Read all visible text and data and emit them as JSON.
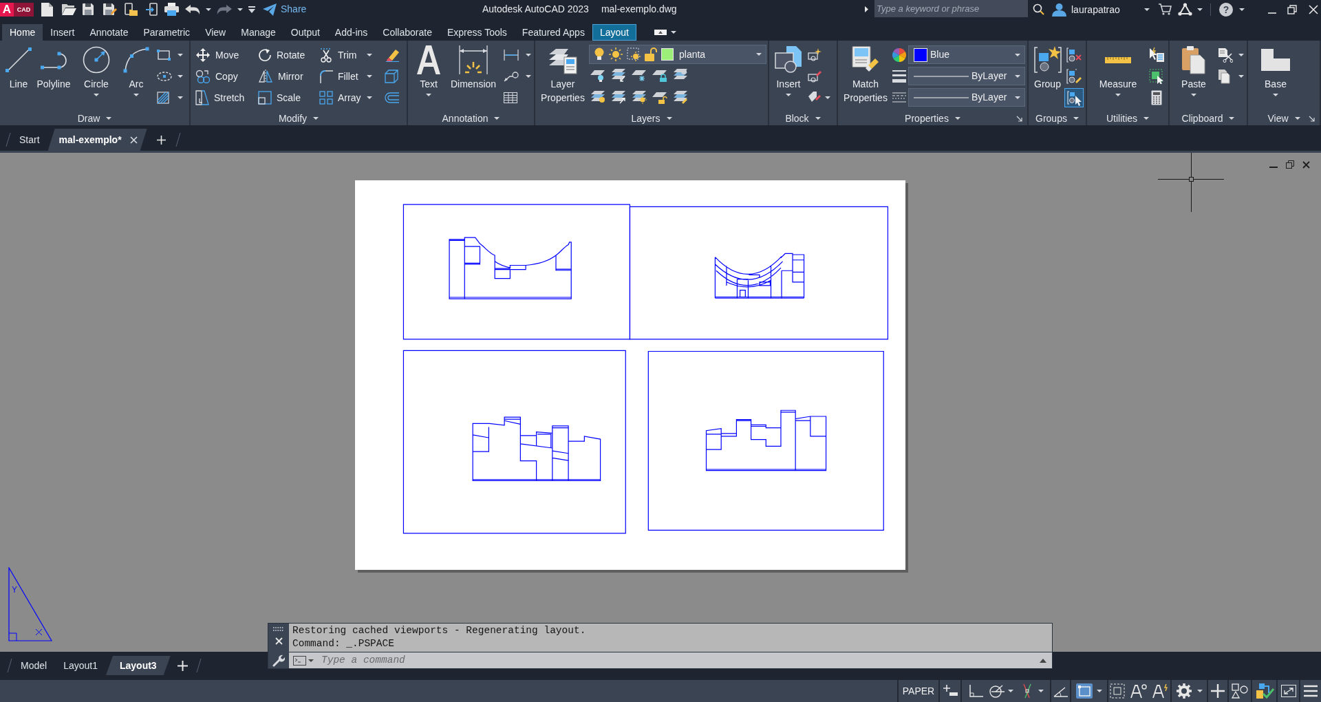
{
  "title_bar": {
    "logo": {
      "mark": "A",
      "text": "CAD"
    },
    "redo": {
      "disabled": true
    },
    "share": "Share",
    "app_title": "Autodesk AutoCAD 2023",
    "file_name": "mal-exemplo.dwg",
    "search": {
      "placeholder": "Type a keyword or phrase"
    },
    "user": "laurapatrao",
    "help": "?"
  },
  "ribbon_tabs": [
    {
      "label": "Home",
      "selected": true,
      "contextual": false
    },
    {
      "label": "Insert",
      "selected": false,
      "contextual": false
    },
    {
      "label": "Annotate",
      "selected": false,
      "contextual": false
    },
    {
      "label": "Parametric",
      "selected": false,
      "contextual": false
    },
    {
      "label": "View",
      "selected": false,
      "contextual": false
    },
    {
      "label": "Manage",
      "selected": false,
      "contextual": false
    },
    {
      "label": "Output",
      "selected": false,
      "contextual": false
    },
    {
      "label": "Add-ins",
      "selected": false,
      "contextual": false
    },
    {
      "label": "Collaborate",
      "selected": false,
      "contextual": false
    },
    {
      "label": "Express Tools",
      "selected": false,
      "contextual": false
    },
    {
      "label": "Featured Apps",
      "selected": false,
      "contextual": false
    },
    {
      "label": "Layout",
      "selected": false,
      "contextual": true
    }
  ],
  "ribbon_panels": [
    {
      "title": "Draw",
      "tools": [
        {
          "label": "Line"
        },
        {
          "label": "Polyline"
        },
        {
          "label": "Circle"
        },
        {
          "label": "Arc"
        }
      ]
    },
    {
      "title": "Modify",
      "tools": [
        {
          "label": "Move"
        },
        {
          "label": "Rotate"
        },
        {
          "label": "Trim"
        },
        {
          "label": "Copy"
        },
        {
          "label": "Mirror"
        },
        {
          "label": "Fillet"
        },
        {
          "label": "Stretch"
        },
        {
          "label": "Scale"
        },
        {
          "label": "Array"
        }
      ]
    },
    {
      "title": "Annotation",
      "tools": [
        {
          "label": "Text"
        },
        {
          "label": "Dimension"
        }
      ]
    },
    {
      "title": "Layers",
      "tools": [
        {
          "label": "Layer Properties"
        }
      ],
      "current_layer": "planta"
    },
    {
      "title": "Block",
      "tools": [
        {
          "label": "Insert"
        }
      ]
    },
    {
      "title": "Properties",
      "tools": [
        {
          "label": "Match Properties"
        }
      ],
      "object_color": "Blue",
      "lineweight": "ByLayer",
      "linetype": "ByLayer"
    },
    {
      "title": "Groups",
      "tools": [
        {
          "label": "Group"
        }
      ],
      "group_selection_on": true
    },
    {
      "title": "Utilities",
      "tools": [
        {
          "label": "Measure"
        }
      ]
    },
    {
      "title": "Clipboard",
      "tools": [
        {
          "label": "Paste"
        }
      ]
    },
    {
      "title": "View",
      "tools": [
        {
          "label": "Base"
        }
      ]
    }
  ],
  "file_tabs": [
    {
      "label": "Start",
      "selected": false
    },
    {
      "label": "mal-exemplo*",
      "selected": true
    }
  ],
  "command_line": {
    "history": [
      "Restoring cached viewports - Regenerating layout.",
      "Command: _.PSPACE"
    ],
    "placeholder": "Type a command"
  },
  "layout_tabs": [
    {
      "label": "Model",
      "selected": false
    },
    {
      "label": "Layout1",
      "selected": false
    },
    {
      "label": "Layout3",
      "selected": true
    }
  ],
  "status_bar": {
    "space": "PAPER",
    "toggles": [
      {
        "on": false
      },
      {
        "on": false
      },
      {
        "on": false
      },
      {
        "on": false
      },
      {
        "on": false
      },
      {
        "on": true
      }
    ]
  }
}
